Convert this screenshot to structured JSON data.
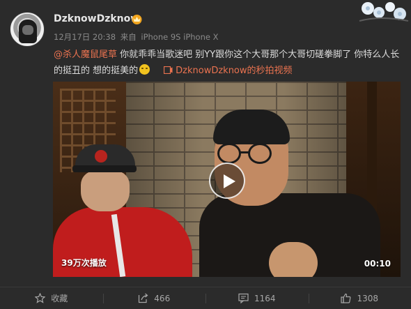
{
  "post": {
    "username": "DzknowDzknow",
    "timestamp": "12月17日 20:38",
    "source_prefix": "来自",
    "source": "iPhone 9S iPhone X",
    "mention": "@杀人魔鼠尾草",
    "body": " 你就乖乖当歌迷吧 别YY跟你这个大哥那个大哥切磋拳脚了 你特么人长的挺丑的 想的挺美的",
    "video_link": "DzknowDzknow的秒拍视频",
    "icons": {
      "vip": "vip-crown-icon",
      "video_link": "video-camera-icon",
      "play": "play-icon",
      "corner": "flower-decoration-icon"
    },
    "colors": {
      "accent": "#eb7350",
      "background": "#2b2b2b"
    }
  },
  "video": {
    "view_count": "39万次播放",
    "duration": "00:10"
  },
  "actions": {
    "favorite_label": "收藏",
    "repost_count": "466",
    "comment_count": "1164",
    "like_count": "1308"
  }
}
